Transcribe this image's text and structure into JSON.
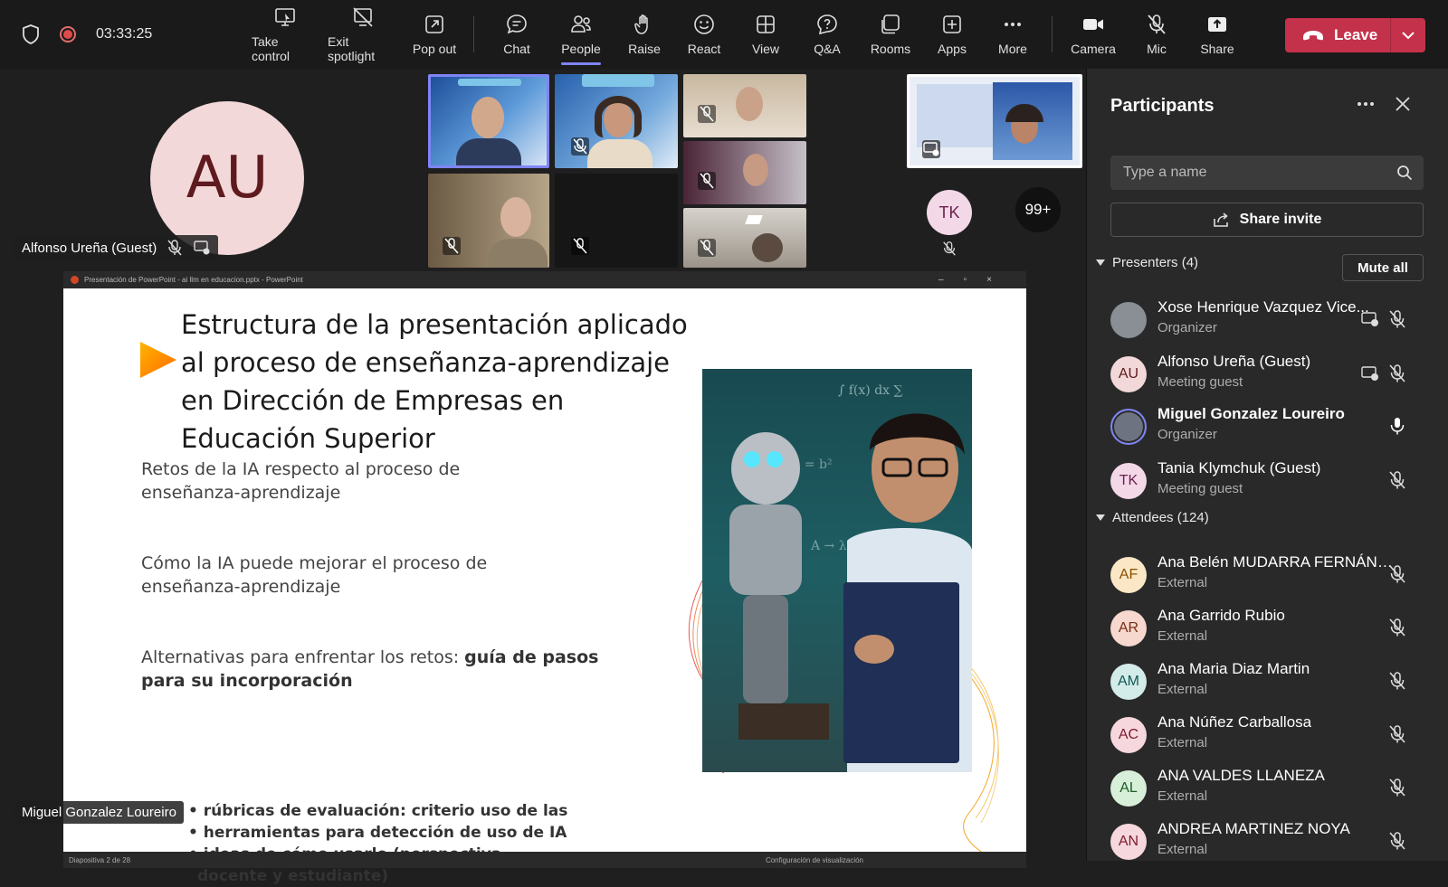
{
  "topbar": {
    "timer": "03:33:25",
    "buttons": [
      {
        "label": "Take control"
      },
      {
        "label": "Exit spotlight"
      },
      {
        "label": "Pop out"
      },
      {
        "label": "Chat"
      },
      {
        "label": "People"
      },
      {
        "label": "Raise"
      },
      {
        "label": "React"
      },
      {
        "label": "View"
      },
      {
        "label": "Q&A"
      },
      {
        "label": "Rooms"
      },
      {
        "label": "Apps"
      },
      {
        "label": "More"
      },
      {
        "label": "Camera"
      },
      {
        "label": "Mic"
      },
      {
        "label": "Share"
      }
    ],
    "leave_label": "Leave"
  },
  "stage": {
    "au_initials": "AU",
    "au_name": "Alfonso Ureña (Guest)",
    "tk_initials": "TK",
    "overflow_count": "99+",
    "presenter_name": "Miguel Gonzalez Loureiro"
  },
  "slide": {
    "window_title": "Presentación de PowerPoint  -  ai llm en educacion.pptx  -  PowerPoint",
    "status_left": "Diapositiva 2 de 28",
    "status_right": "Configuración de visualización",
    "title": "Estructura de la presentación aplicado al proceso de enseñanza-aprendizaje en Dirección de Empresas en Educación Superior",
    "point1": "Retos de la IA respecto al proceso de enseñanza-aprendizaje",
    "point2": "Cómo la IA puede mejorar el proceso de enseñanza-aprendizaje",
    "point3_normal": "Alternativas para enfrentar los retos: ",
    "point3_bold": "guía de pasos para su incorporación",
    "bullets": [
      "rúbricas de evaluación: criterio uso de las",
      "herramientas para detección de uso de IA",
      "ideas de cómo usarlo (perspectiva docente y estudiante)"
    ]
  },
  "sidebar": {
    "title": "Participants",
    "search_placeholder": "Type a name",
    "share_invite": "Share invite",
    "presenters_header": "Presenters (4)",
    "mute_all": "Mute all",
    "attendees_header": "Attendees (124)",
    "presenters": [
      {
        "initials": "",
        "name": "Xose Henrique Vazquez Vice...",
        "role": "Organizer",
        "bg": "#8a8f95",
        "fg": "#ffffff"
      },
      {
        "initials": "AU",
        "name": "Alfonso Ureña (Guest)",
        "role": "Meeting guest",
        "bg": "#f3d8d9",
        "fg": "#5e1a1e"
      },
      {
        "initials": "",
        "name": "Miguel Gonzalez Loureiro",
        "role": "Organizer",
        "bg": "#6d7380",
        "fg": "#ffffff"
      },
      {
        "initials": "TK",
        "name": "Tania Klymchuk (Guest)",
        "role": "Meeting guest",
        "bg": "#f3d8e8",
        "fg": "#6b1f4d"
      }
    ],
    "attendees": [
      {
        "initials": "AF",
        "name": "Ana Belén MUDARRA FERNÁND...",
        "role": "External",
        "bg": "#fbe7c6",
        "fg": "#8a4f00"
      },
      {
        "initials": "AR",
        "name": "Ana Garrido Rubio",
        "role": "External",
        "bg": "#f6d8cf",
        "fg": "#7a2d15"
      },
      {
        "initials": "AM",
        "name": "Ana Maria Diaz Martin",
        "role": "External",
        "bg": "#d4ece9",
        "fg": "#0f5a55"
      },
      {
        "initials": "AC",
        "name": "Ana Núñez Carballosa",
        "role": "External",
        "bg": "#f7d7de",
        "fg": "#7a1a2c"
      },
      {
        "initials": "AL",
        "name": "ANA VALDES LLANEZA",
        "role": "External",
        "bg": "#d7efd9",
        "fg": "#1c5c23"
      },
      {
        "initials": "AN",
        "name": "ANDREA MARTINEZ NOYA",
        "role": "External",
        "bg": "#f7d7de",
        "fg": "#7a1a2c"
      }
    ]
  }
}
